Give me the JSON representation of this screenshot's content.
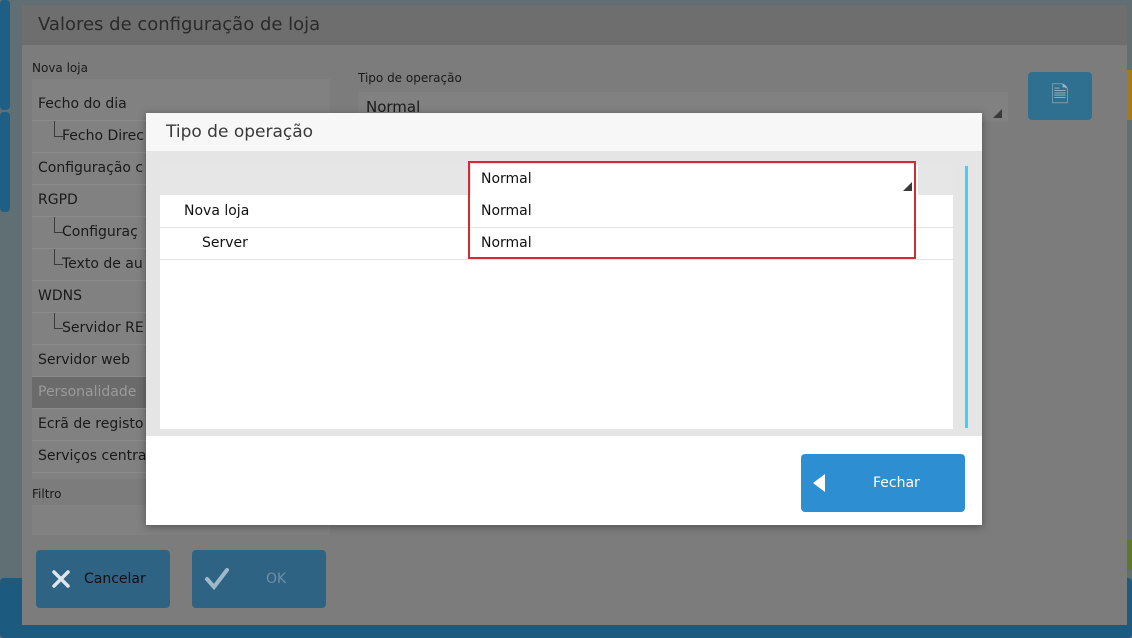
{
  "window": {
    "title": "Valores de configuração de loja",
    "store_label": "Nova loja",
    "filter_label": "Filtro",
    "operation_type_label": "Tipo de operação",
    "operation_type_value": "Normal",
    "doc_icon": "document-icon"
  },
  "tree": {
    "items": [
      {
        "label": "Fecho do dia",
        "level": 0,
        "selected": false
      },
      {
        "label": "Fecho Direc",
        "level": 1,
        "selected": false
      },
      {
        "label": "Configuração c",
        "level": 0,
        "selected": false
      },
      {
        "label": "RGPD",
        "level": 0,
        "selected": false
      },
      {
        "label": "Configuraç",
        "level": 1,
        "selected": false
      },
      {
        "label": "Texto de au",
        "level": 1,
        "selected": false
      },
      {
        "label": "WDNS",
        "level": 0,
        "selected": false
      },
      {
        "label": "Servidor RE",
        "level": 1,
        "selected": false
      },
      {
        "label": "Servidor web",
        "level": 0,
        "selected": false
      },
      {
        "label": "Personalidade",
        "level": 0,
        "selected": true
      },
      {
        "label": "Ecrã de registo",
        "level": 0,
        "selected": false
      },
      {
        "label": "Serviços centra",
        "level": 0,
        "selected": false
      }
    ]
  },
  "buttons": {
    "cancel": "Cancelar",
    "ok": "OK"
  },
  "modal": {
    "title": "Tipo de operação",
    "header_value": "Normal",
    "rows": [
      {
        "name": "Nova loja",
        "value": "Normal"
      },
      {
        "name": "Server",
        "value": "Normal"
      }
    ],
    "close_label": "Fechar"
  },
  "colors": {
    "accent": "#2d8fd1",
    "highlight": "#d12b34",
    "scrollbar": "#3fd2f5"
  }
}
